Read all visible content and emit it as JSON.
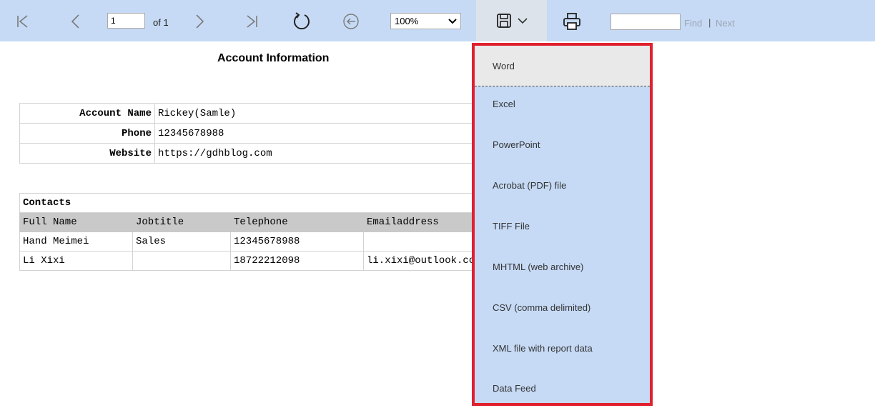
{
  "toolbar": {
    "page_number": "1",
    "page_of": "of 1",
    "zoom": "100%",
    "find_placeholder": "",
    "find_label": "Find",
    "separator": "|",
    "next_label": "Next"
  },
  "report": {
    "title": "Account Information",
    "account_info": [
      {
        "label": "Account Name",
        "value": "Rickey(Samle)"
      },
      {
        "label": "Phone",
        "value": "12345678988"
      },
      {
        "label": "Website",
        "value": "https://gdhblog.com"
      }
    ],
    "contacts": {
      "section_title": "Contacts",
      "columns": [
        "Full Name",
        "Jobtitle",
        "Telephone",
        "Emailaddress"
      ],
      "rows": [
        [
          "Hand Meimei",
          "Sales",
          "12345678988",
          ""
        ],
        [
          "Li Xixi",
          "",
          "18722212098",
          "li.xixi@outlook.com"
        ]
      ]
    }
  },
  "export_menu": {
    "items": [
      "Word",
      "Excel",
      "PowerPoint",
      "Acrobat (PDF) file",
      "TIFF File",
      "MHTML (web archive)",
      "CSV (comma delimited)",
      "XML file with report data",
      "Data Feed"
    ]
  },
  "colors": {
    "toolbar_bg": "#c6daf5",
    "menu_border": "#e0202e",
    "table_header_bg": "#c9c9c9"
  }
}
